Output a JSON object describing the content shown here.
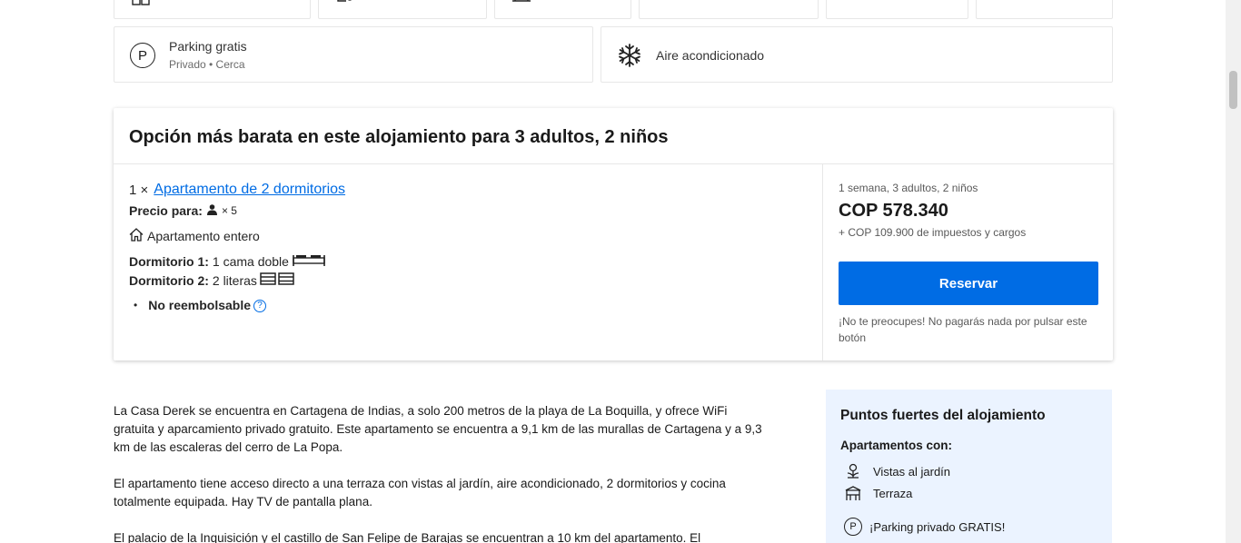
{
  "facilities": {
    "parking": {
      "title": "Parking gratis",
      "subtitle": "Privado • Cerca",
      "icon": "parking-icon"
    },
    "ac": {
      "title": "Aire acondicionado",
      "icon": "snowflake-icon"
    }
  },
  "cheapest": {
    "heading": "Opción más barata en este alojamiento para 3 adultos, 2 niños",
    "quantity": "1 ×",
    "room_link": "Apartamento de 2 dormitorios",
    "price_for_label": "Precio para:",
    "guests": "× 5",
    "property_type": "Apartamento entero",
    "bedroom1_label": "Dormitorio 1:",
    "bedroom1_value": "1 cama doble",
    "bedroom2_label": "Dormitorio 2:",
    "bedroom2_value": "2 literas",
    "policy": "No reembolsable",
    "stay_summary": "1 semana, 3 adultos, 2 niños",
    "price": "COP 578.340",
    "taxes": "+ COP 109.900 de impuestos y cargos",
    "reserve_button": "Reservar",
    "reassurance": "¡No te preocupes! No pagarás nada por pulsar este botón"
  },
  "description": {
    "p1": "La Casa Derek se encuentra en Cartagena de Indias, a solo 200 metros de la playa de La Boquilla, y ofrece WiFi gratuita y aparcamiento privado gratuito. Este apartamento se encuentra a 9,1 km de las murallas de Cartagena y a 9,3 km de las escaleras del cerro de La Popa.",
    "p2": "El apartamento tiene acceso directo a una terraza con vistas al jardín, aire acondicionado, 2 dormitorios y cocina totalmente equipada. Hay TV de pantalla plana.",
    "p3": "El palacio de la Inquisición y el castillo de San Felipe de Barajas se encuentran a 10 km del apartamento. El"
  },
  "strengths": {
    "title": "Puntos fuertes del alojamiento",
    "subtitle": "Apartamentos con:",
    "items": [
      {
        "label": "Vistas al jardín",
        "icon": "garden-view-icon"
      },
      {
        "label": "Terraza",
        "icon": "terrace-icon"
      }
    ],
    "parking": {
      "label": "¡Parking privado GRATIS!",
      "icon": "parking-icon"
    }
  },
  "colors": {
    "accent": "#006ce4",
    "strengths_bg": "#ebf3ff"
  }
}
